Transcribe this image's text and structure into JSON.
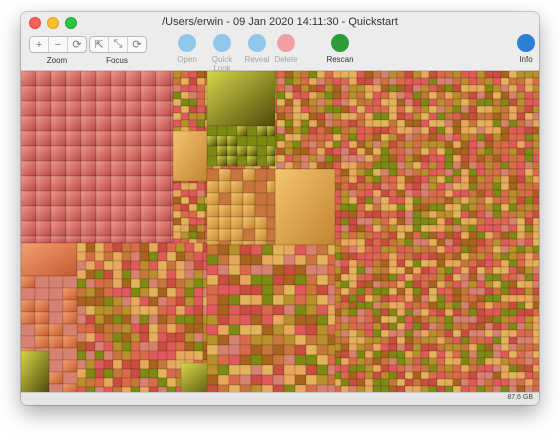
{
  "window": {
    "title": "/Users/erwin - 09 Jan 2020 14:11:30 - Quickstart"
  },
  "toolbar": {
    "zoom": {
      "label": "Zoom",
      "buttons": [
        "+",
        "−",
        "⟳"
      ]
    },
    "focus": {
      "label": "Focus",
      "buttons": [
        "⇱",
        "⤡",
        "⟳"
      ]
    },
    "actions": [
      {
        "label": "Open",
        "icon": "open-icon",
        "enabled": false,
        "color": "#8fc8e8"
      },
      {
        "label": "Quick Look",
        "icon": "eye-icon",
        "enabled": false,
        "color": "#8fc8e8"
      },
      {
        "label": "Reveal",
        "icon": "magnifier-icon",
        "enabled": false,
        "color": "#8fc8e8"
      },
      {
        "label": "Delete",
        "icon": "delete-icon",
        "enabled": false,
        "color": "#f0a0a0"
      },
      {
        "label": "Rescan",
        "icon": "rescan-icon",
        "enabled": true,
        "color": "#2d9b3a"
      },
      {
        "label": "Info",
        "icon": "info-icon",
        "enabled": true,
        "color": "#2b7fd4"
      }
    ]
  },
  "status": {
    "total_size": "87,6 GB"
  },
  "treemap": {
    "palette": [
      "#e05a5a",
      "#d96b4a",
      "#c8763b",
      "#e2b35a",
      "#b8902c",
      "#7f8a14",
      "#c94e3f",
      "#e8a75c",
      "#d78270",
      "#a8641f"
    ]
  }
}
